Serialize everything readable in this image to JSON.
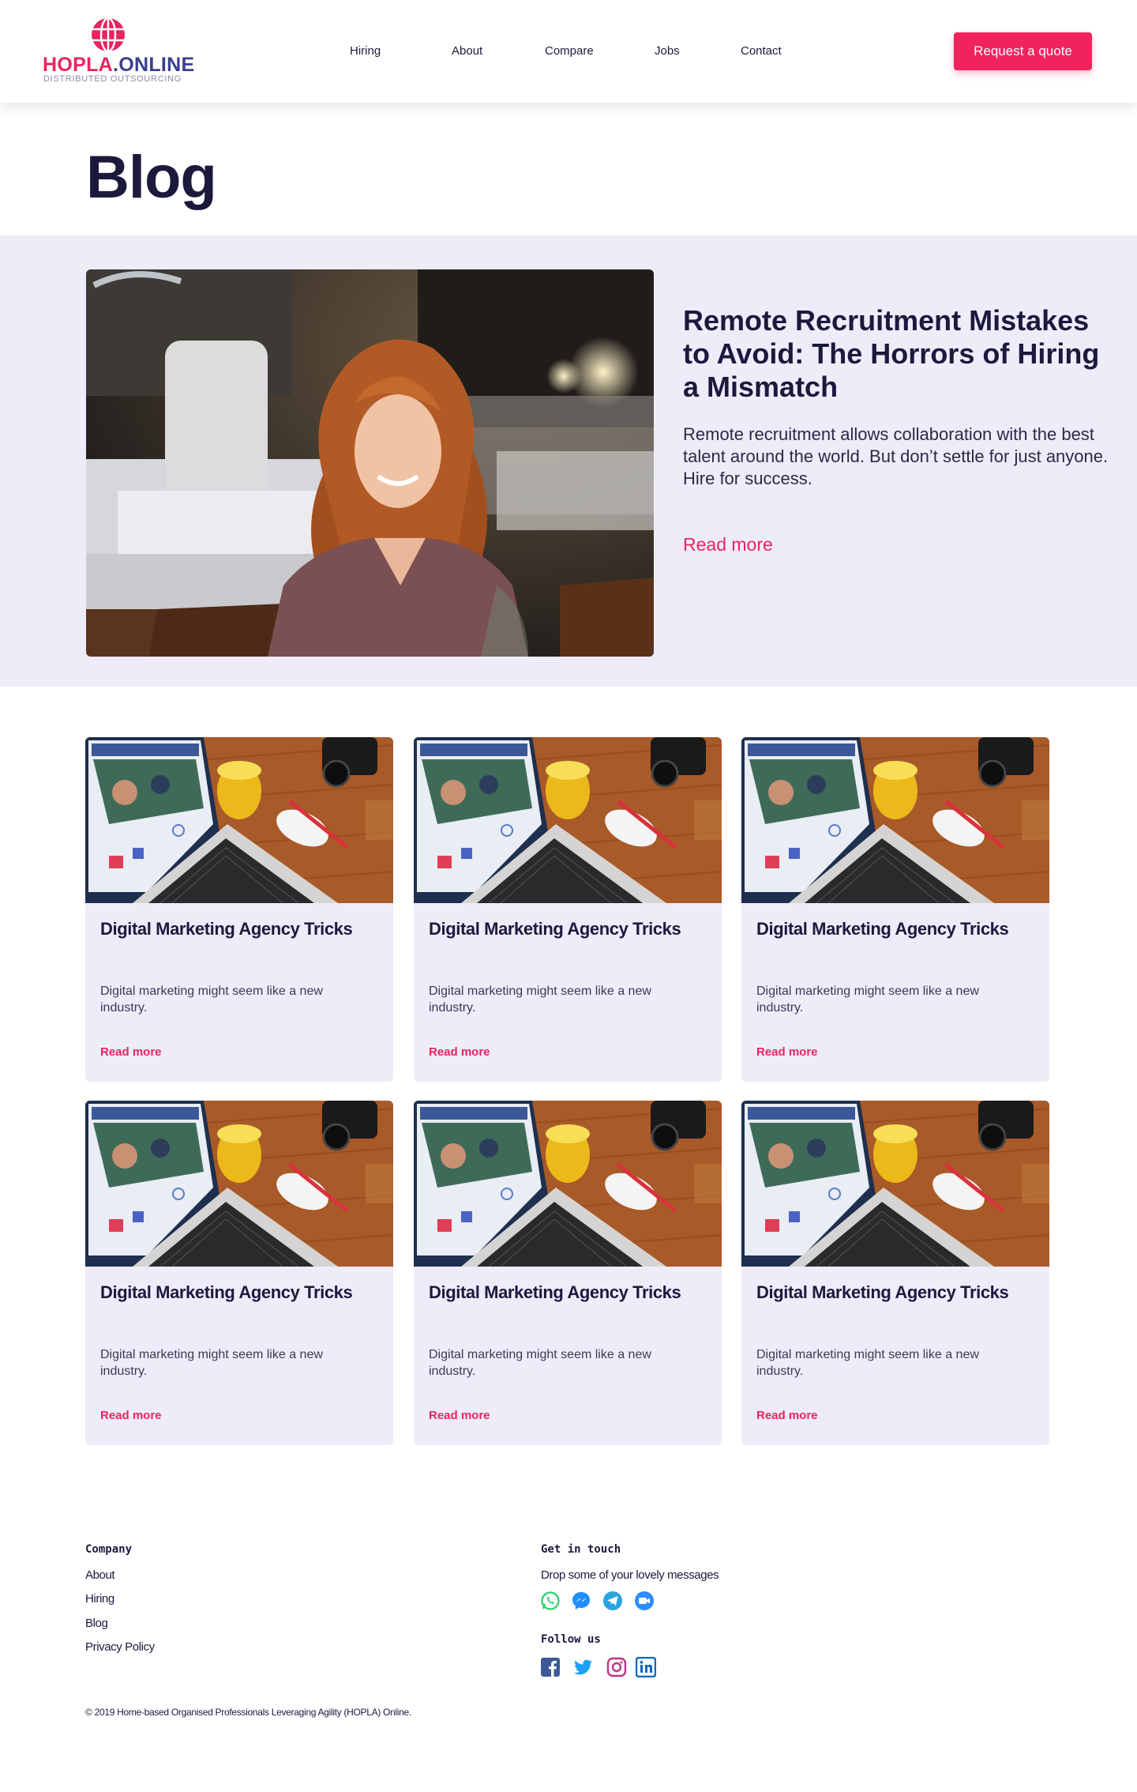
{
  "header": {
    "logo": {
      "name_part1": "HOPLA",
      "name_part2": ".ONLINE",
      "tagline": "DISTRIBUTED OUTSOURCING"
    },
    "nav": [
      "Hiring",
      "About",
      "Compare",
      "Jobs",
      "Contact"
    ],
    "cta_label": "Request a quote"
  },
  "page": {
    "title": "Blog"
  },
  "featured": {
    "title": "Remote Recruitment Mistakes to Avoid: The Horrors of Hiring a Mismatch",
    "excerpt": "Remote recruitment allows collaboration with the best talent around the world. But don’t settle for just anyone. Hire for success.",
    "read_more": "Read more"
  },
  "posts": [
    {
      "title": "Digital Marketing Agency Tricks",
      "excerpt": "Digital marketing might seem like a new industry.",
      "read_more": "Read more"
    },
    {
      "title": "Digital Marketing Agency Tricks",
      "excerpt": "Digital marketing might seem like a new industry.",
      "read_more": "Read more"
    },
    {
      "title": "Digital Marketing Agency Tricks",
      "excerpt": "Digital marketing might seem like a new industry.",
      "read_more": "Read more"
    },
    {
      "title": "Digital Marketing Agency Tricks",
      "excerpt": "Digital marketing might seem like a new industry.",
      "read_more": "Read more"
    },
    {
      "title": "Digital Marketing Agency Tricks",
      "excerpt": "Digital marketing might seem like a new industry.",
      "read_more": "Read more"
    },
    {
      "title": "Digital Marketing Agency Tricks",
      "excerpt": "Digital marketing might seem like a new industry.",
      "read_more": "Read more"
    }
  ],
  "footer": {
    "company_heading": "Company",
    "company_links": [
      "About",
      "Hiring",
      "Blog",
      "Privacy Policy"
    ],
    "contact_heading": "Get in touch",
    "contact_text": "Drop some of your lovely messages",
    "contact_icons": [
      "whatsapp-icon",
      "messenger-icon",
      "telegram-icon",
      "zoom-icon"
    ],
    "follow_heading": "Follow us",
    "social_icons": [
      "facebook-icon",
      "twitter-icon",
      "instagram-icon",
      "linkedin-icon"
    ],
    "copyright": "© 2019 Home-based Organised Professionals Leveraging Agility (HOPLA) Online."
  },
  "colors": {
    "accent": "#f0235d",
    "brand_navy": "#3b3f8f",
    "text_dark": "#1b1a3d",
    "section_bg": "#eeecf9"
  }
}
